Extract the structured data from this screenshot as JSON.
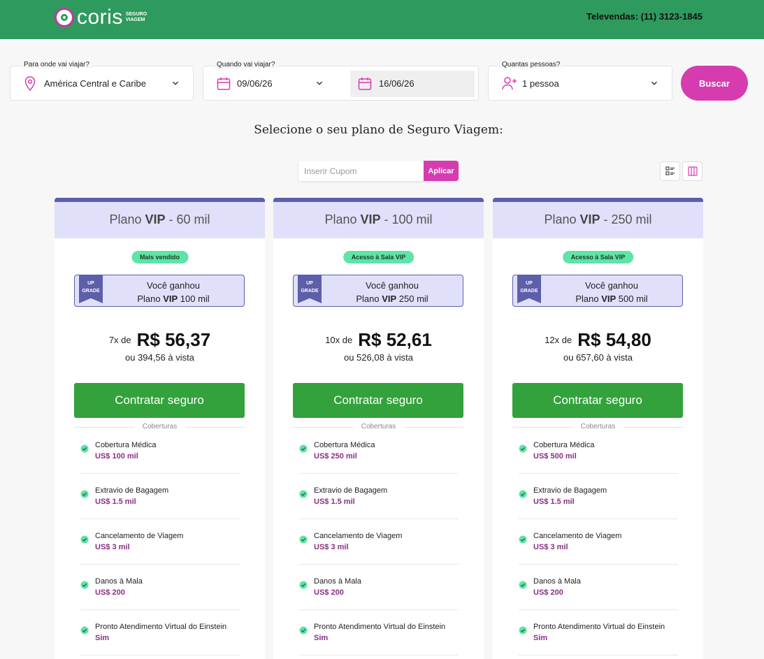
{
  "header": {
    "logo_text": "coris",
    "logo_sub_line1": "SEGURO",
    "logo_sub_line2": "VIAGEM",
    "phone": "Televendas: (11) 3123-1845"
  },
  "search": {
    "destination_label": "Para onde vai viajar?",
    "destination_value": "América Central e Caribe",
    "dates_label": "Quando vai viajar?",
    "date_start": "09/06/26",
    "date_end": "16/06/26",
    "people_label": "Quantas pessoas?",
    "people_value": "1 pessoa",
    "search_button": "Buscar"
  },
  "page_title": "Selecione o seu plano de Seguro Viagem:",
  "coupon": {
    "placeholder": "Inserir Cupom",
    "apply_label": "Aplicar"
  },
  "colors": {
    "header_green": "#2e9a5e",
    "accent_pink": "#d63cb0",
    "buy_green": "#33a23c",
    "plan_purple": "#5d5faa",
    "badge_green": "#5ee4a6"
  },
  "coverages_title": "Coberturas",
  "plans": [
    {
      "name_prefix": "Plano ",
      "name_bold": "VIP",
      "name_suffix": " - 60 mil",
      "badge": "Mais vendido",
      "ribbon_top": "UP",
      "ribbon_bottom": "GRADE",
      "upgrade_line1": "Você ganhou",
      "upgrade_plan_prefix": "Plano ",
      "upgrade_plan_bold": "VIP",
      "upgrade_plan_suffix": " 100 mil",
      "installments": "7x de",
      "price": "R$ 56,37",
      "cash": "ou 394,56 à vista",
      "buy_label": "Contratar seguro",
      "coverages": [
        {
          "name": "Cobertura Médica",
          "value": "US$ 100 mil"
        },
        {
          "name": "Extravio de Bagagem",
          "value": "US$ 1.5 mil"
        },
        {
          "name": "Cancelamento de Viagem",
          "value": "US$ 3 mil"
        },
        {
          "name": "Danos à Mala",
          "value": "US$ 200"
        },
        {
          "name": "Pronto Atendimento Virtual do Einstein",
          "value": "Sim"
        }
      ]
    },
    {
      "name_prefix": "Plano ",
      "name_bold": "VIP",
      "name_suffix": " - 100 mil",
      "badge": "Acesso à Sala VIP",
      "ribbon_top": "UP",
      "ribbon_bottom": "GRADE",
      "upgrade_line1": "Você ganhou",
      "upgrade_plan_prefix": "Plano ",
      "upgrade_plan_bold": "VIP",
      "upgrade_plan_suffix": " 250 mil",
      "installments": "10x de",
      "price": "R$ 52,61",
      "cash": "ou 526,08 à vista",
      "buy_label": "Contratar seguro",
      "coverages": [
        {
          "name": "Cobertura Médica",
          "value": "US$ 250 mil"
        },
        {
          "name": "Extravio de Bagagem",
          "value": "US$ 1.5 mil"
        },
        {
          "name": "Cancelamento de Viagem",
          "value": "US$ 3 mil"
        },
        {
          "name": "Danos à Mala",
          "value": "US$ 200"
        },
        {
          "name": "Pronto Atendimento Virtual do Einstein",
          "value": "Sim"
        }
      ]
    },
    {
      "name_prefix": "Plano ",
      "name_bold": "VIP",
      "name_suffix": " - 250 mil",
      "badge": "Acesso à Sala VIP",
      "ribbon_top": "UP",
      "ribbon_bottom": "GRADE",
      "upgrade_line1": "Você ganhou",
      "upgrade_plan_prefix": "Plano ",
      "upgrade_plan_bold": "VIP",
      "upgrade_plan_suffix": " 500 mil",
      "installments": "12x de",
      "price": "R$ 54,80",
      "cash": "ou 657,60 à vista",
      "buy_label": "Contratar seguro",
      "coverages": [
        {
          "name": "Cobertura Médica",
          "value": "US$ 500 mil"
        },
        {
          "name": "Extravio de Bagagem",
          "value": "US$ 1.5 mil"
        },
        {
          "name": "Cancelamento de Viagem",
          "value": "US$ 3 mil"
        },
        {
          "name": "Danos à Mala",
          "value": "US$ 200"
        },
        {
          "name": "Pronto Atendimento Virtual do Einstein",
          "value": "Sim"
        }
      ]
    }
  ]
}
